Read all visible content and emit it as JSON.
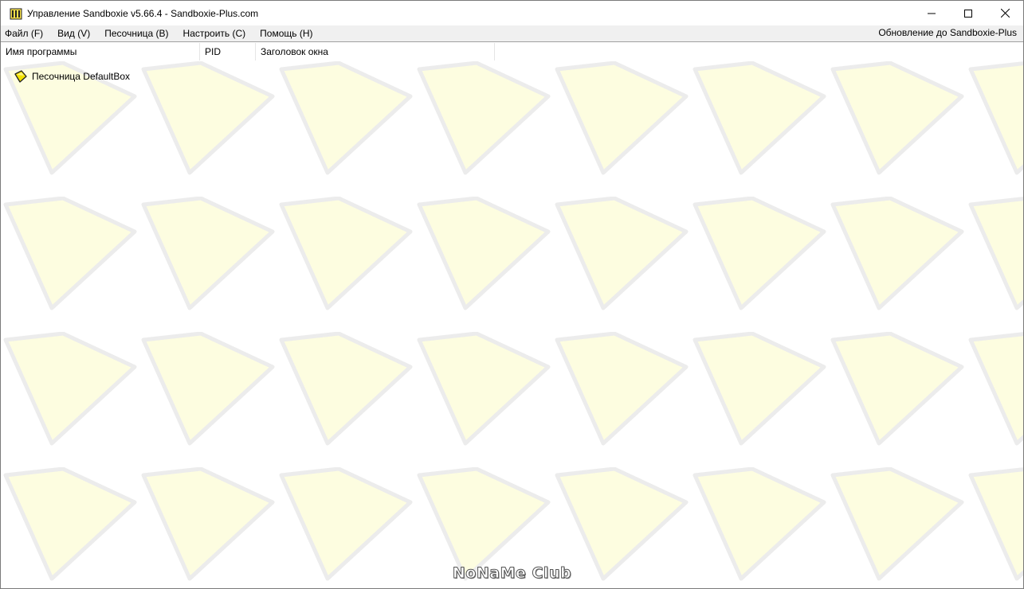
{
  "window": {
    "title": "Управление Sandboxie v5.66.4 - Sandboxie-Plus.com",
    "app_icon": "sandboxie-icon",
    "controls": [
      "minimize-icon",
      "maximize-icon",
      "close-icon"
    ]
  },
  "menu": {
    "items": [
      {
        "label": "Файл (F)"
      },
      {
        "label": "Вид (V)"
      },
      {
        "label": "Песочница (B)"
      },
      {
        "label": "Настроить (C)"
      },
      {
        "label": "Помощь (H)"
      }
    ],
    "update_link": "Обновление до Sandboxie-Plus"
  },
  "columns": {
    "name": "Имя программы",
    "pid": "PID",
    "title": "Заголовок окна"
  },
  "tree": {
    "items": [
      {
        "label": "Песочница DefaultBox",
        "icon": "sandbox-icon"
      }
    ]
  },
  "colors": {
    "pattern_fill": "#fdfde0",
    "pattern_stroke": "#efefef",
    "box_icon": "#f2e200"
  },
  "watermark": "NoNaMe Club"
}
